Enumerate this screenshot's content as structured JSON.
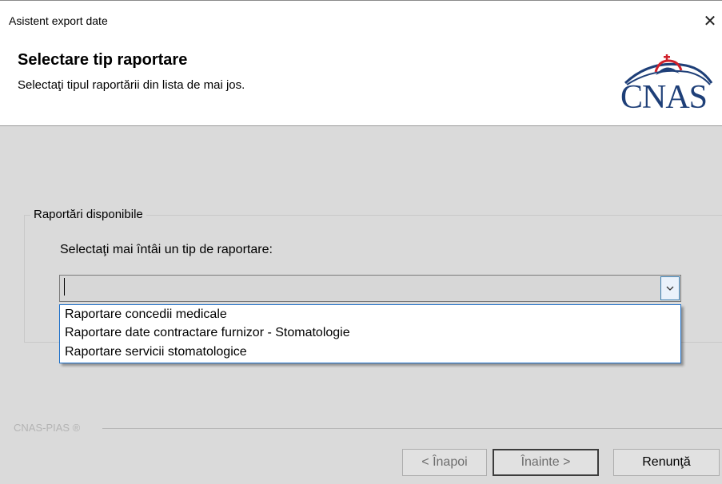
{
  "window": {
    "title": "Asistent export date",
    "close_glyph": "✕"
  },
  "header": {
    "title": "Selectare tip raportare",
    "subtitle": "Selectaţi tipul raportării din lista de mai jos.",
    "logo_text": "CNAS",
    "logo_icon": "cnas-logo-icon"
  },
  "group": {
    "legend": "Raportări disponibile",
    "instruction": "Selectaţi mai întâi un tip de raportare:",
    "combo_value": "",
    "dropdown_items": [
      "Raportare concedii medicale",
      "Raportare date contractare furnizor - Stomatologie",
      "Raportare servicii stomatologice"
    ]
  },
  "footer": {
    "brand": "CNAS-PIAS ®"
  },
  "buttons": {
    "back": "< Înapoi",
    "next": "Înainte >",
    "cancel": "Renunţă"
  },
  "colors": {
    "accent_blue": "#1c6fc9",
    "logo_blue": "#1e3f78",
    "logo_red": "#d0202a",
    "panel_gray": "#dadada"
  }
}
